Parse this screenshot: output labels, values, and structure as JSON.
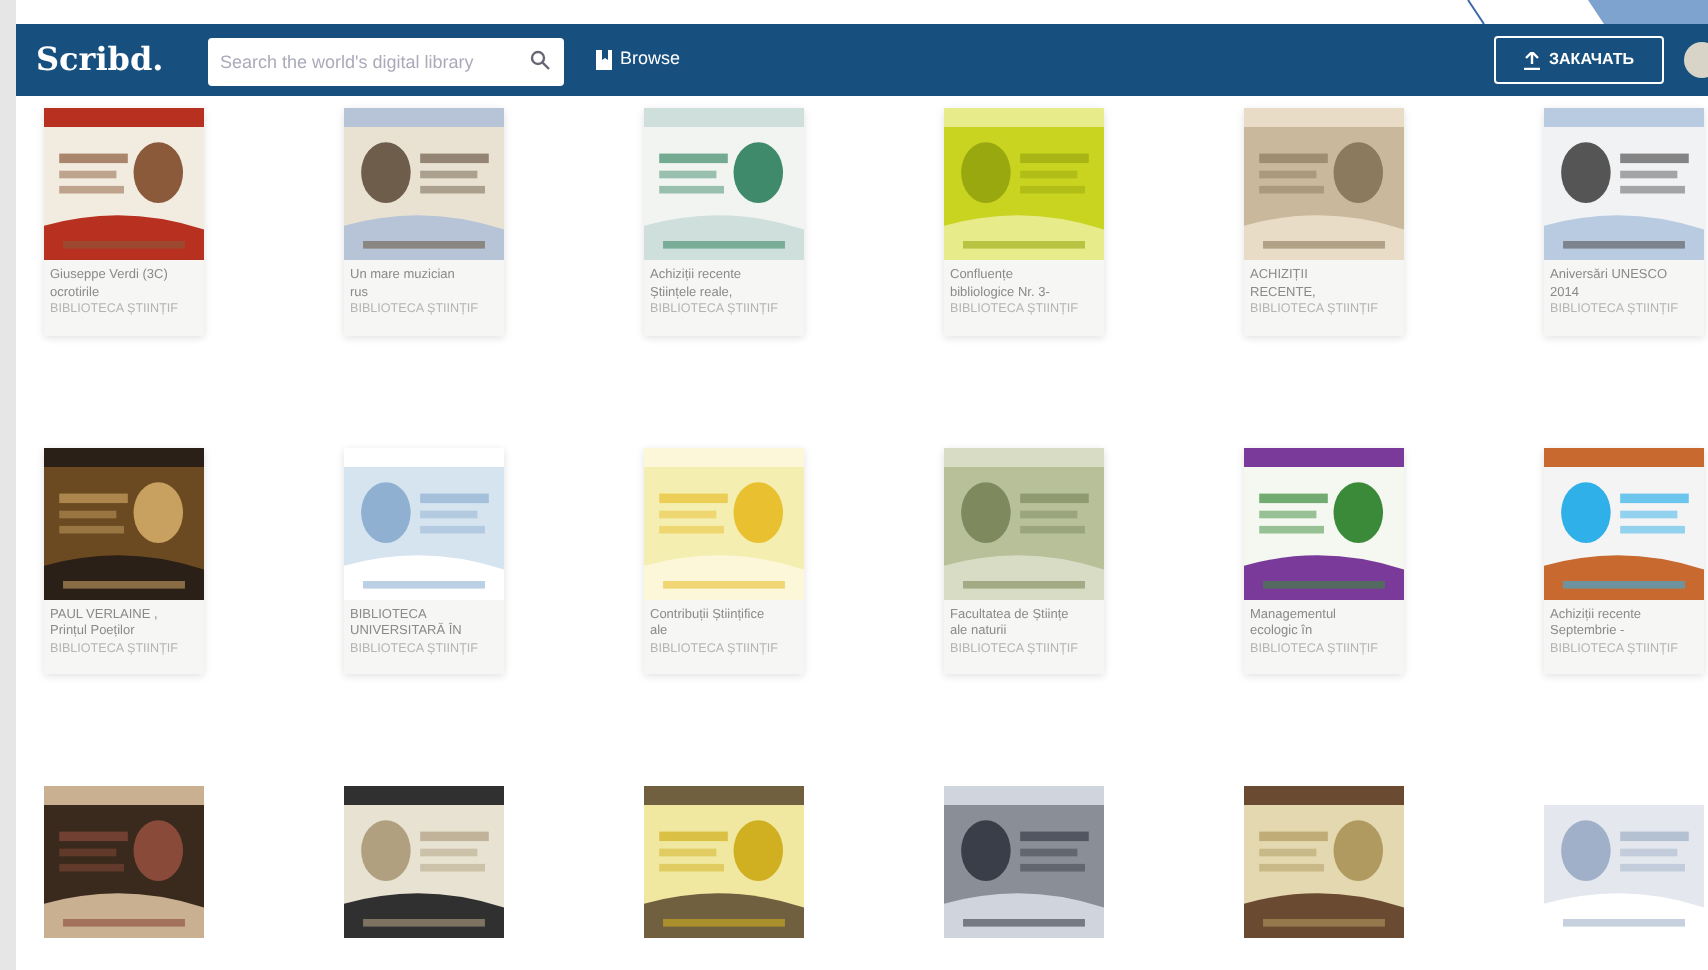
{
  "header": {
    "logo": "Scribd.",
    "search": {
      "placeholder": "Search the world's digital library"
    },
    "browse": "Browse",
    "upload_button": "ЗАКАЧАТЬ"
  },
  "rows": [
    [
      {
        "kind": "document",
        "title": "Giuseppe Verdi (3C) ocrotirile",
        "author": "BIBLIOTECA ȘTIINȚIF"
      },
      {
        "kind": "document",
        "title": "Un mare muzician rus",
        "author": "BIBLIOTECA ȘTIINȚIF"
      },
      {
        "kind": "document",
        "title": "Achiziții recente Științele reale,",
        "author": "BIBLIOTECA ȘTIINȚIF"
      },
      {
        "kind": "document",
        "title": "Confluențe bibliologice Nr. 3-",
        "author": "BIBLIOTECA ȘTIINȚIF"
      },
      {
        "kind": "document",
        "title": "ACHIZIȚII RECENTE,",
        "author": "BIBLIOTECA ȘTIINȚIF"
      },
      {
        "kind": "document",
        "title": "Aniversări UNESCO 2014",
        "author": "BIBLIOTECA ȘTIINȚIF"
      }
    ],
    [
      {
        "kind": "document",
        "title": "PAUL VERLAINE , Prințul Poeților",
        "author": "BIBLIOTECA ȘTIINȚIF"
      },
      {
        "kind": "document",
        "title": "BIBLIOTECA UNIVERSITARĂ ÎN",
        "author": "BIBLIOTECA ȘTIINȚIF"
      },
      {
        "kind": "document",
        "title": "Contribuții Științifice ale",
        "author": "BIBLIOTECA ȘTIINȚIF"
      },
      {
        "kind": "document",
        "title": "Facultatea de Științe ale naturii",
        "author": "BIBLIOTECA ȘTIINȚIF"
      },
      {
        "kind": "document",
        "title": "Managementul ecologic în",
        "author": "BIBLIOTECA ȘTIINȚIF"
      },
      {
        "kind": "document",
        "title": "Achiziții recente Septembrie -",
        "author": "BIBLIOTECA ȘTIINȚIF"
      }
    ],
    [
      {
        "kind": "picture"
      },
      {
        "kind": "picture"
      },
      {
        "kind": "picture"
      },
      {
        "kind": "picture"
      },
      {
        "kind": "picture"
      },
      {
        "kind": "picture"
      }
    ]
  ]
}
